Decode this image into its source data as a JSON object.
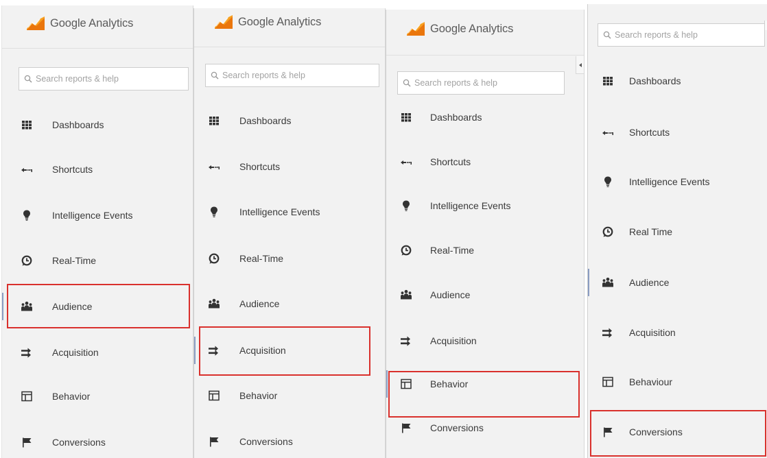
{
  "app": {
    "name": "Google Analytics"
  },
  "search": {
    "placeholder": "Search reports & help"
  },
  "colors": {
    "highlight": "#d9302c",
    "panel_bg": "#f2f2f2",
    "logo_orange": "#f7a120",
    "logo_dark_orange": "#e8710a"
  },
  "panels": [
    {
      "items": [
        "Dashboards",
        "Shortcuts",
        "Intelligence Events",
        "Real-Time",
        "Audience",
        "Acquisition",
        "Behavior",
        "Conversions"
      ],
      "highlighted": "Audience"
    },
    {
      "items": [
        "Dashboards",
        "Shortcuts",
        "Intelligence Events",
        "Real-Time",
        "Audience",
        "Acquisition",
        "Behavior",
        "Conversions"
      ],
      "highlighted": "Acquisition"
    },
    {
      "items": [
        "Dashboards",
        "Shortcuts",
        "Intelligence Events",
        "Real-Time",
        "Audience",
        "Acquisition",
        "Behavior",
        "Conversions"
      ],
      "highlighted": "Behavior"
    },
    {
      "items": [
        "Dashboards",
        "Shortcuts",
        "Intelligence Events",
        "Real Time",
        "Audience",
        "Acquisition",
        "Behaviour",
        "Conversions"
      ],
      "highlighted": "Conversions"
    }
  ],
  "icons": [
    "grid-icon",
    "shortcut-arrow-icon",
    "lightbulb-icon",
    "clock-icon",
    "people-icon",
    "arrows-icon",
    "layout-icon",
    "flag-icon"
  ]
}
